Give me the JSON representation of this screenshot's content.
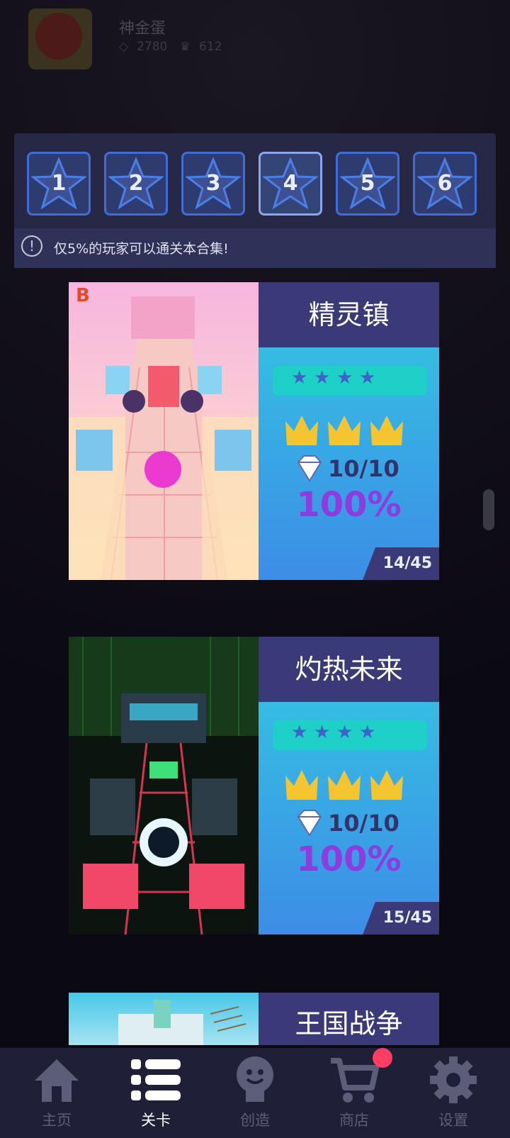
{
  "profile": {
    "username": "神金蛋",
    "gems": "2780",
    "crowns": "612"
  },
  "stars": [
    {
      "label": "1"
    },
    {
      "label": "2"
    },
    {
      "label": "3"
    },
    {
      "label": "4"
    },
    {
      "label": "5"
    },
    {
      "label": "6"
    }
  ],
  "notice": {
    "icon": "!",
    "text": "仅5%的玩家可以通关本合集!"
  },
  "levels": [
    {
      "title": "精灵镇",
      "badge": "B",
      "stars": 4,
      "crowns": 3,
      "gems": "10/10",
      "percent": "100%",
      "index": "14/45"
    },
    {
      "title": "灼热未来",
      "badge": "",
      "stars": 4,
      "crowns": 3,
      "gems": "10/10",
      "percent": "100%",
      "index": "15/45"
    },
    {
      "title": "王国战争"
    }
  ],
  "nav": {
    "home": "主页",
    "levels": "关卡",
    "create": "创造",
    "shop": "商店",
    "settings": "设置"
  },
  "colors": {
    "accent": "#3f6cd6",
    "panel": "#272845",
    "card_title": "#3a3a78",
    "percent": "#8e3bdf",
    "notify": "#ff3c64"
  }
}
